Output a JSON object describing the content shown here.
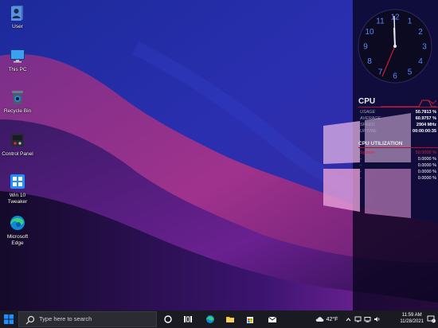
{
  "desktop": {
    "icons": [
      {
        "label": "User",
        "icon": "user-folder-icon"
      },
      {
        "label": "This PC",
        "icon": "monitor-icon"
      },
      {
        "label": "Recycle Bin",
        "icon": "recycle-bin-icon"
      },
      {
        "label": "Control Panel",
        "icon": "control-panel-icon"
      },
      {
        "label": "Win 10\nTweaker",
        "icon": "tweaker-icon"
      },
      {
        "label": "Microsoft\nEdge",
        "icon": "edge-icon"
      }
    ]
  },
  "clock_gadget": {
    "numbers": [
      "12",
      "1",
      "2",
      "3",
      "4",
      "5",
      "6",
      "7",
      "8",
      "9",
      "10",
      "11"
    ],
    "time": "11:59"
  },
  "cpu_meter": {
    "title": "CPU",
    "rows": [
      {
        "label": "USAGE",
        "value": "50.7813 %"
      },
      {
        "label": "AVERAGE",
        "value": "60.9757 %"
      },
      {
        "label": "SPEED",
        "value": "2904 MHz"
      },
      {
        "label": "UPTIME",
        "value": "00:00:00:35"
      }
    ],
    "utilization_title": "CPU UTILIZATION",
    "cores": [
      {
        "label": "System",
        "value": "50.0000 %"
      },
      {
        "label": "-",
        "value": "0.0000 %"
      },
      {
        "label": "-",
        "value": "0.0000 %"
      },
      {
        "label": "-",
        "value": "0.0000 %"
      },
      {
        "label": "-",
        "value": "0.0000 %"
      }
    ],
    "accent": "#e0203a"
  },
  "taskbar": {
    "search_placeholder": "Type here to search",
    "pinned": [
      "cortana-icon",
      "task-view-icon",
      "edge-icon",
      "file-explorer-icon",
      "store-icon",
      "mail-icon"
    ],
    "weather_temp": "42°F",
    "time": "11:59 AM",
    "date": "11/28/2021",
    "notification_count": "2"
  },
  "colors": {
    "taskbar": "#1a1a22",
    "start_blue": "#1e90ff"
  }
}
